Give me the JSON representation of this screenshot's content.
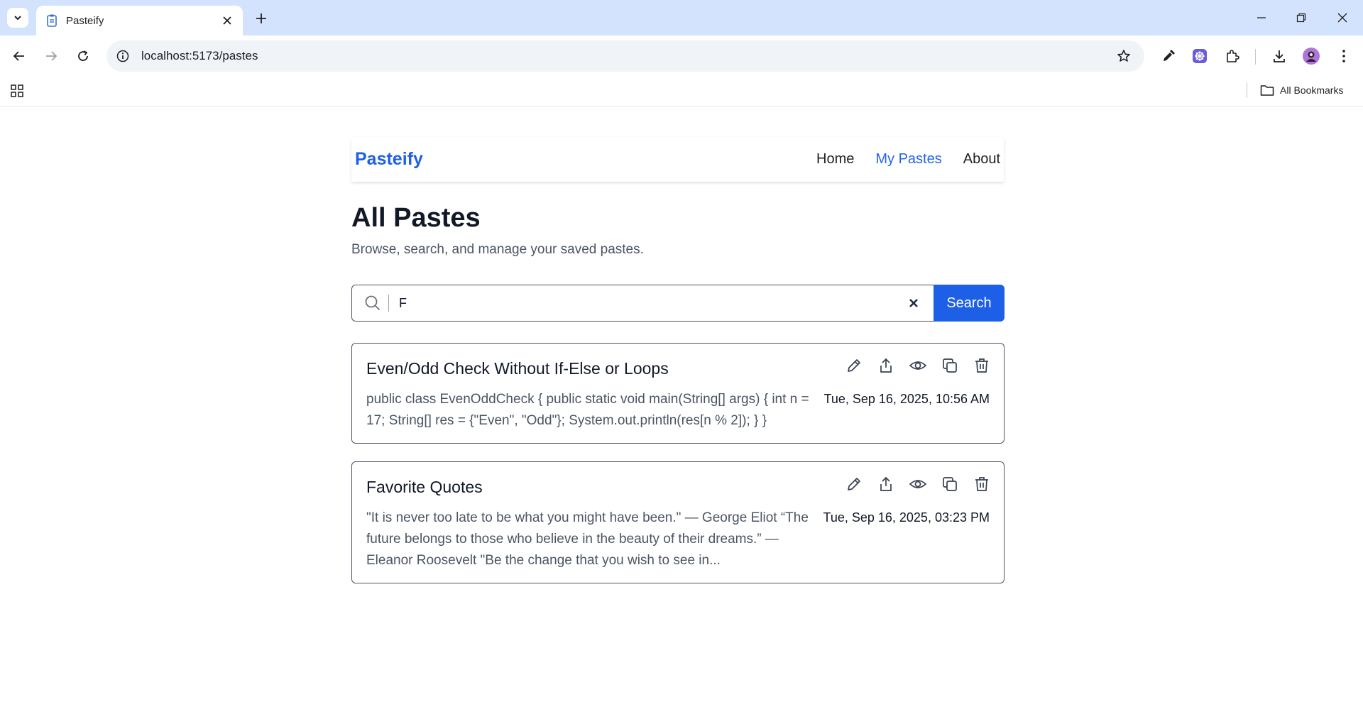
{
  "browser": {
    "tab_title": "Pasteify",
    "url": "localhost:5173/pastes",
    "bookmarks_label": "All Bookmarks",
    "icons": [
      "tab-search-icon",
      "favicon-icon",
      "close-icon",
      "plus-icon",
      "minimize-icon",
      "restore-icon",
      "close-window-icon",
      "back-icon",
      "forward-icon",
      "reload-icon",
      "info-icon",
      "star-icon",
      "eyedropper-icon",
      "extension-icon",
      "puzzle-icon",
      "download-icon",
      "avatar",
      "kebab-menu-icon",
      "apps-grid-icon",
      "folder-icon"
    ]
  },
  "nav": {
    "brand": "Pasteify",
    "links": [
      "Home",
      "My Pastes",
      "About"
    ],
    "active": "My Pastes"
  },
  "header": {
    "title": "All Pastes",
    "subtitle": "Browse, search, and manage your saved pastes."
  },
  "search": {
    "value": "F",
    "button_label": "Search"
  },
  "pastes": [
    {
      "title": "Even/Odd Check Without If-Else or Loops",
      "content": "public class EvenOddCheck { public static void main(String[] args) { int n = 17; String[] res = {\"Even\", \"Odd\"}; System.out.println(res[n % 2]); } }",
      "date": "Tue, Sep 16, 2025, 10:56 AM"
    },
    {
      "title": "Favorite Quotes",
      "content": "\"It is never too late to be what you might have been.\" — George Eliot “The future belongs to those who believe in the beauty of their dreams.” — Eleanor Roosevelt \"Be the change that you wish to see in...",
      "date": "Tue, Sep 16, 2025, 03:23 PM"
    }
  ],
  "colors": {
    "brand": "#1d5fe6",
    "active_link": "#2563eb",
    "tabstrip": "#d3e3fd"
  }
}
